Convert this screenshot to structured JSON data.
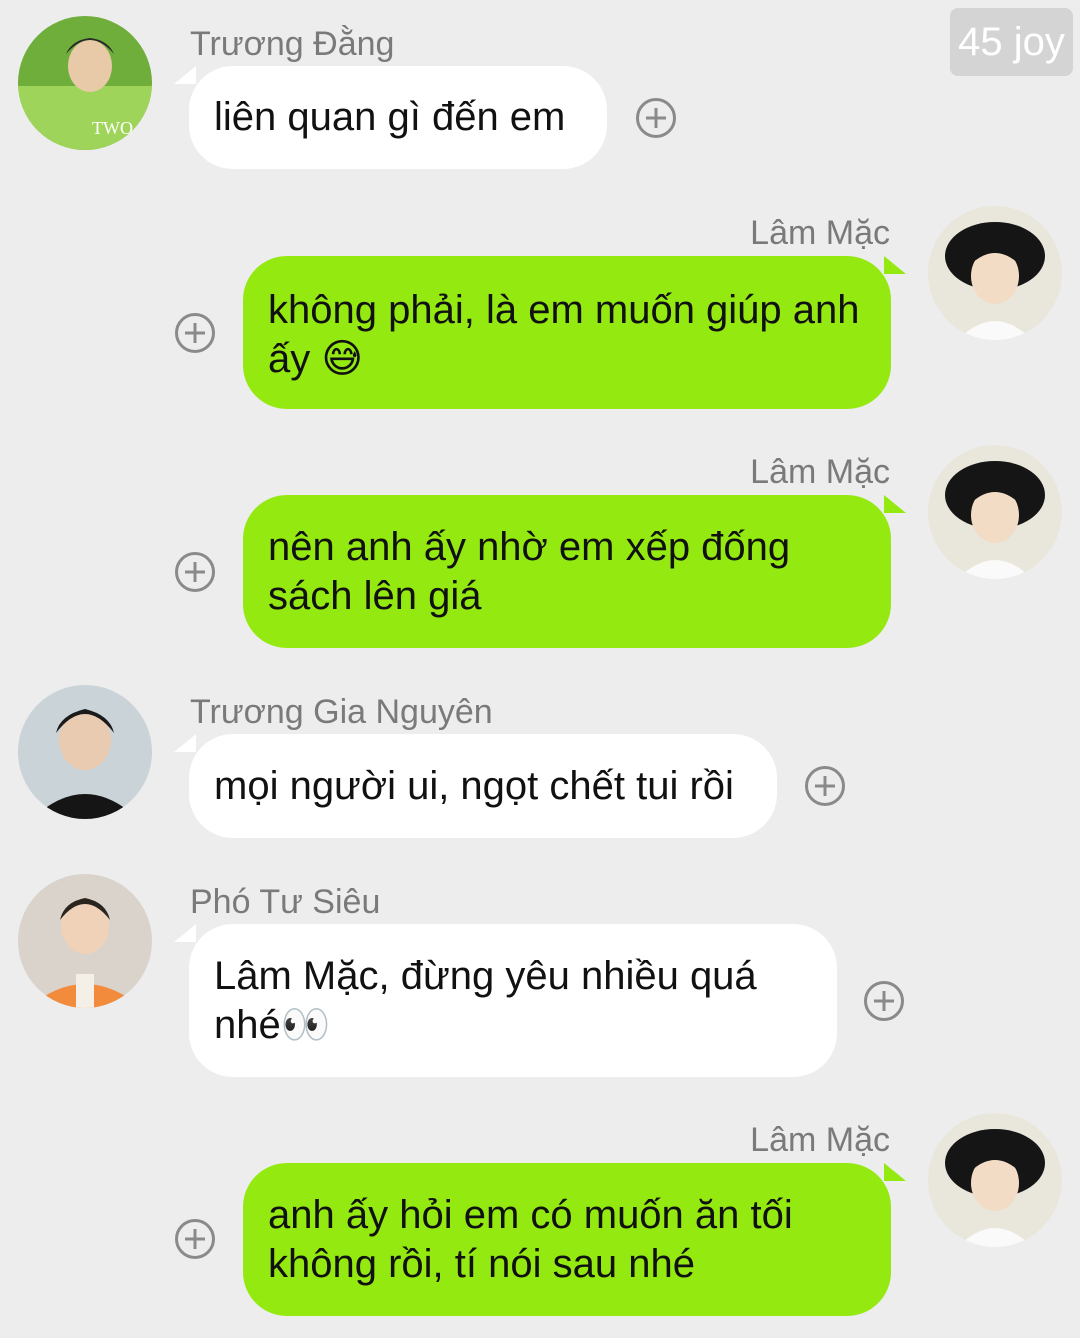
{
  "watermark": "45 joy",
  "messages": [
    {
      "sender": "Trương Đằng",
      "text": "liên quan gì đến em",
      "side": "left"
    },
    {
      "sender": "Lâm Mặc",
      "text": "không phải, là em muốn giúp anh ấy 😅",
      "side": "right"
    },
    {
      "sender": "Lâm Mặc",
      "text": "nên anh ấy nhờ em xếp đống sách lên giá",
      "side": "right"
    },
    {
      "sender": "Trương Gia Nguyên",
      "text": "mọi người ui, ngọt chết tui rồi",
      "side": "left"
    },
    {
      "sender": "Phó Tư Siêu",
      "text": "Lâm Mặc, đừng yêu nhiều quá nhé👀",
      "side": "left"
    },
    {
      "sender": "Lâm Mặc",
      "text": "anh ấy hỏi em có muốn ăn tối không rồi, tí nói sau nhé",
      "side": "right"
    }
  ],
  "colors": {
    "background": "#ededed",
    "own_bubble": "#93e910",
    "other_bubble": "#ffffff",
    "sender_name": "#7a7a7a",
    "icon": "#8a8a8a"
  },
  "icons": {
    "add_reaction": "plus-circle-icon"
  }
}
